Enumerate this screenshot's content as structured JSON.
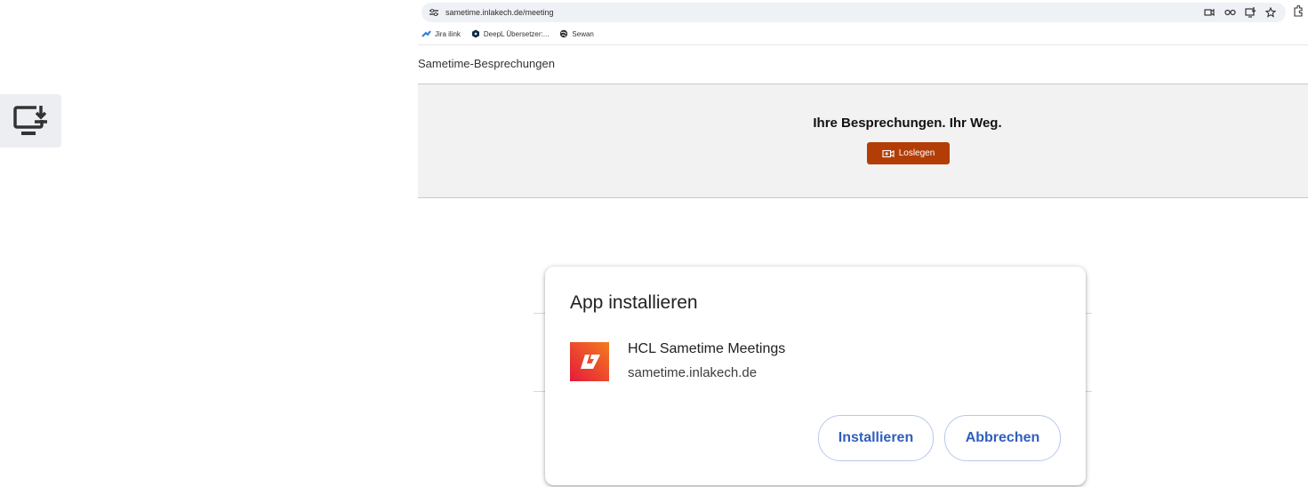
{
  "browser": {
    "url": "sametime.inlakech.de/meeting",
    "bookmarks": [
      {
        "label": "Jira ilink",
        "icon": "jira-icon"
      },
      {
        "label": "DeepL Übersetzer:...",
        "icon": "deepl-icon"
      },
      {
        "label": "Sewan",
        "icon": "globe-icon"
      }
    ],
    "address_icons": [
      "camera-icon",
      "password-key-icon",
      "install-app-icon",
      "bookmark-star-icon"
    ],
    "extension_icon": "extensions-puzzle-icon"
  },
  "page": {
    "title": "Sametime-Besprechungen",
    "hero_title": "Ihre Besprechungen. Ihr Weg.",
    "start_button": "Loslegen"
  },
  "dialog": {
    "title": "App installieren",
    "app_name": "HCL Sametime Meetings",
    "app_host": "sametime.inlakech.de",
    "install_button": "Installieren",
    "cancel_button": "Abbrechen"
  },
  "colors": {
    "start_button_bg": "#b33d06",
    "dialog_button_text": "#2f5fbf",
    "dialog_button_border": "#b6c8ec"
  }
}
